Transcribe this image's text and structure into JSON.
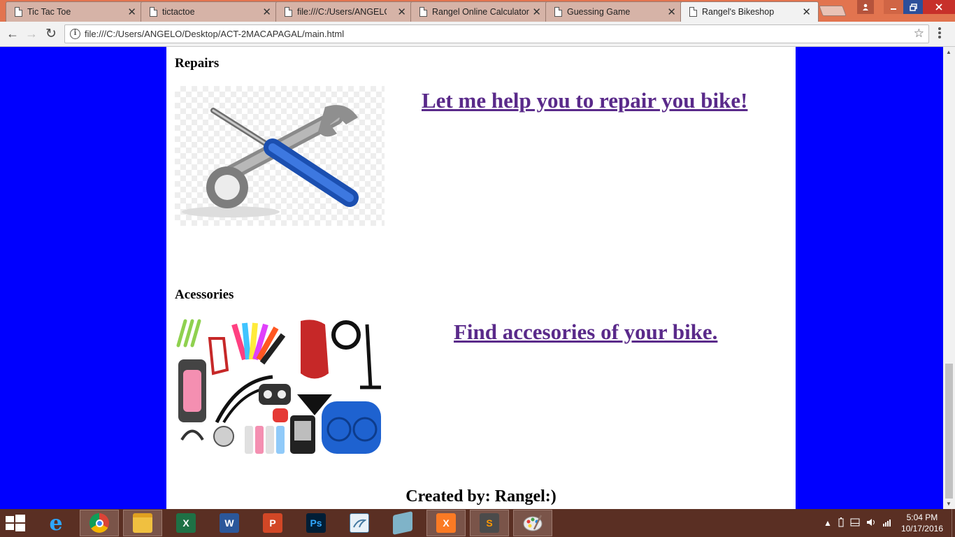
{
  "browser": {
    "tabs": [
      {
        "label": "Tic Tac Toe",
        "active": false
      },
      {
        "label": "tictactoe",
        "active": false
      },
      {
        "label": "file:///C:/Users/ANGELO/",
        "active": false
      },
      {
        "label": "Rangel Online Calculator",
        "active": false
      },
      {
        "label": "Guessing Game",
        "active": false
      },
      {
        "label": "Rangel's Bikeshop",
        "active": true
      }
    ],
    "close_glyph": "✕",
    "address_bar": {
      "url": "file:///C:/Users/ANGELO/Desktop/ACT-2MACAPAGAL/main.html",
      "info_glyph": "i",
      "star_glyph": "☆"
    },
    "nav": {
      "back": "←",
      "forward": "→",
      "reload": "↻"
    }
  },
  "page": {
    "background_color": "#0000ff",
    "content_background": "#ffffff",
    "link_color": "#5a2a8a",
    "sections": [
      {
        "title": "Repairs",
        "image_alt": "wrench and screwdriver icon",
        "link_text": "Let me help you to repair you bike!"
      },
      {
        "title": "Acessories",
        "image_alt": "assorted bike accessories",
        "link_text": "Find accesories of your bike."
      }
    ],
    "footer": "Created by: Rangel:)"
  },
  "taskbar": {
    "apps": [
      {
        "name": "internet-explorer",
        "glyph": "e",
        "color": "#1e90ff"
      },
      {
        "name": "chrome",
        "glyph": "",
        "color": "#db4437"
      },
      {
        "name": "file-explorer",
        "glyph": "",
        "color": "#f0c040"
      },
      {
        "name": "excel",
        "glyph": "X",
        "color": "#1e7145"
      },
      {
        "name": "word",
        "glyph": "W",
        "color": "#2b579a"
      },
      {
        "name": "powerpoint",
        "glyph": "P",
        "color": "#d24726"
      },
      {
        "name": "photoshop",
        "glyph": "Ps",
        "color": "#001e36"
      },
      {
        "name": "mysql-installer",
        "glyph": "",
        "color": "#4479a1"
      },
      {
        "name": "notes-app",
        "glyph": "",
        "color": "#7fb3c8"
      },
      {
        "name": "xampp",
        "glyph": "X",
        "color": "#fb7a24"
      },
      {
        "name": "sublime-text",
        "glyph": "S",
        "color": "#4b4b4b"
      },
      {
        "name": "paint",
        "glyph": "",
        "color": "#e8e8e8"
      }
    ],
    "clock": {
      "time": "5:04 PM",
      "date": "10/17/2016"
    }
  }
}
